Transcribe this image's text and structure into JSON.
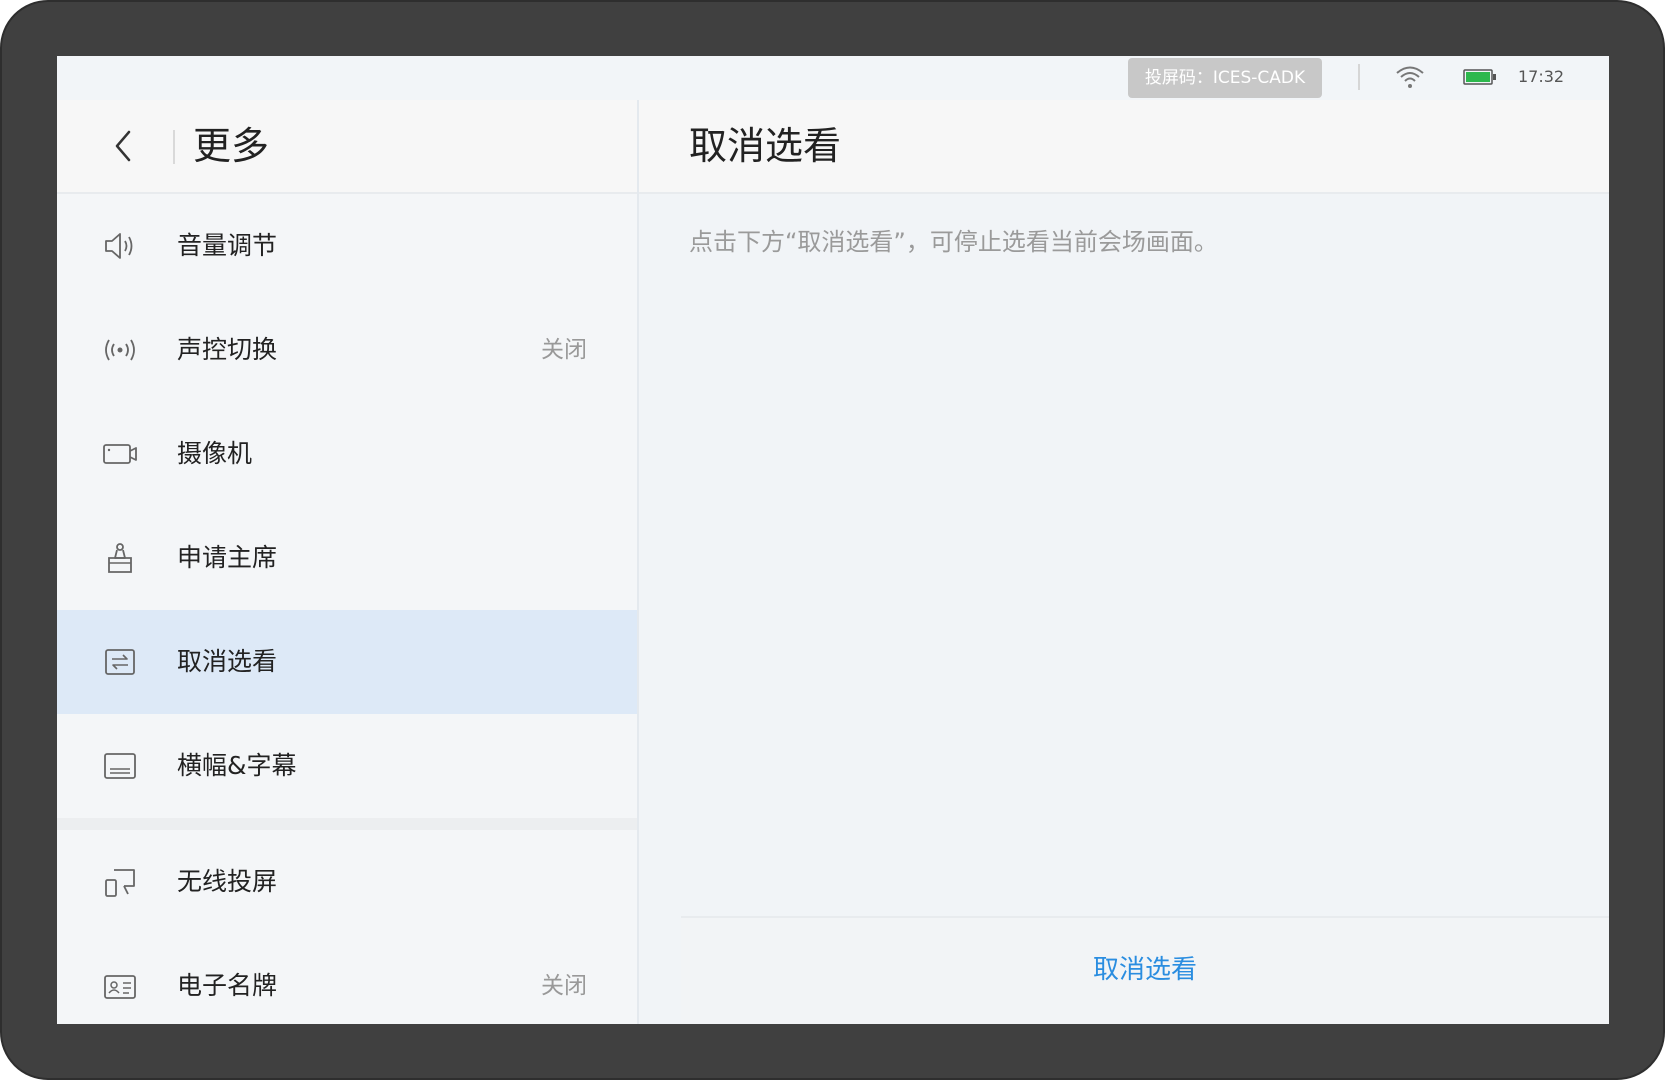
{
  "status_bar": {
    "cast_code": "投屏码：ICES-CADK",
    "time": "17:32",
    "icons": [
      "wifi-icon",
      "battery-icon"
    ],
    "battery_color": "#2db84d"
  },
  "left_panel": {
    "title": "更多",
    "back_icon": "chevron-left-icon",
    "items": [
      {
        "label": "音量调节",
        "value": "",
        "icon": "speaker-icon"
      },
      {
        "label": "声控切换",
        "value": "关闭",
        "icon": "voice-control-icon"
      },
      {
        "label": "摄像机",
        "value": "",
        "icon": "camera-icon"
      },
      {
        "label": "申请主席",
        "value": "",
        "icon": "chair-icon"
      },
      {
        "label": "取消选看",
        "value": "",
        "icon": "switch-view-icon",
        "active": true
      },
      {
        "label": "横幅&字幕",
        "value": "",
        "icon": "subtitle-icon"
      },
      {
        "label": "无线投屏",
        "value": "",
        "icon": "wireless-cast-icon"
      },
      {
        "label": "电子名牌",
        "value": "关闭",
        "icon": "nameplate-icon"
      }
    ]
  },
  "right_panel": {
    "title": "取消选看",
    "description": "点击下方“取消选看”，可停止选看当前会场画面。",
    "action_label": "取消选看",
    "action_color": "#2a8de0"
  },
  "colors": {
    "bezel": "#404040",
    "active_item_bg": "#dde9f7",
    "accent": "#2a8de0"
  }
}
